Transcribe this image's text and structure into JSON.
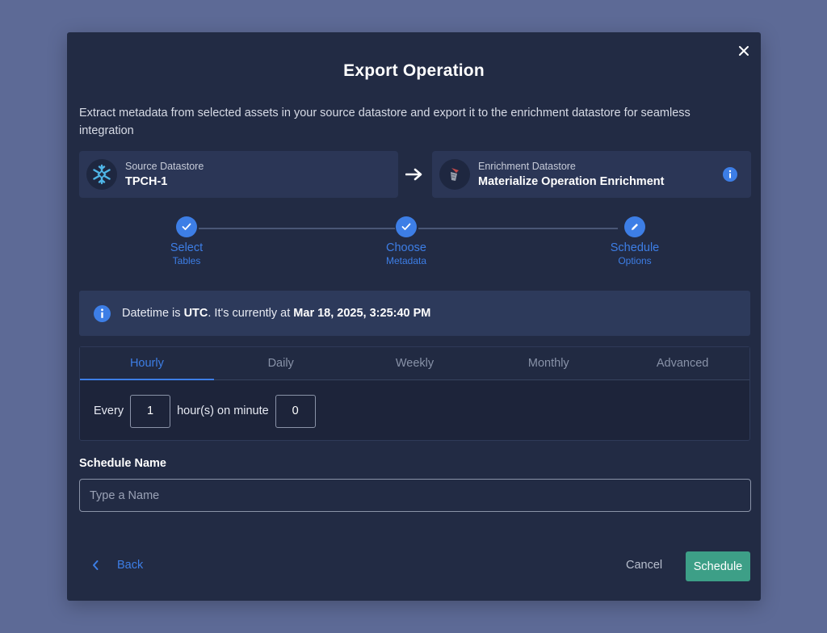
{
  "modal": {
    "title": "Export Operation",
    "description": "Extract metadata from selected assets in your source datastore and export it to the enrichment datastore for seamless integration"
  },
  "source": {
    "label": "Source Datastore",
    "name": "TPCH-1",
    "icon": "snowflake-icon"
  },
  "enrichment": {
    "label": "Enrichment Datastore",
    "name": "Materialize Operation Enrichment",
    "icon": "materialize-icon"
  },
  "steps": [
    {
      "title": "Select",
      "subtitle": "Tables",
      "state": "done"
    },
    {
      "title": "Choose",
      "subtitle": "Metadata",
      "state": "done"
    },
    {
      "title": "Schedule",
      "subtitle": "Options",
      "state": "active"
    }
  ],
  "notice": {
    "prefix": "Datetime is ",
    "timezone": "UTC",
    "middle": ". It's currently at ",
    "datetime": "Mar 18, 2025, 3:25:40 PM"
  },
  "schedule_tabs": [
    {
      "label": "Hourly",
      "active": true
    },
    {
      "label": "Daily",
      "active": false
    },
    {
      "label": "Weekly",
      "active": false
    },
    {
      "label": "Monthly",
      "active": false
    },
    {
      "label": "Advanced",
      "active": false
    }
  ],
  "hourly": {
    "every_label": "Every",
    "hours_value": "1",
    "minute_label": "hour(s) on minute",
    "minute_value": "0"
  },
  "schedule_name": {
    "label": "Schedule Name",
    "placeholder": "Type a Name",
    "value": ""
  },
  "footer": {
    "back_label": "Back",
    "cancel_label": "Cancel",
    "schedule_label": "Schedule"
  },
  "colors": {
    "accent": "#3d7ee6",
    "primary_button": "#3d9f87",
    "modal_bg": "#222b44",
    "page_bg": "#5d6a96"
  }
}
